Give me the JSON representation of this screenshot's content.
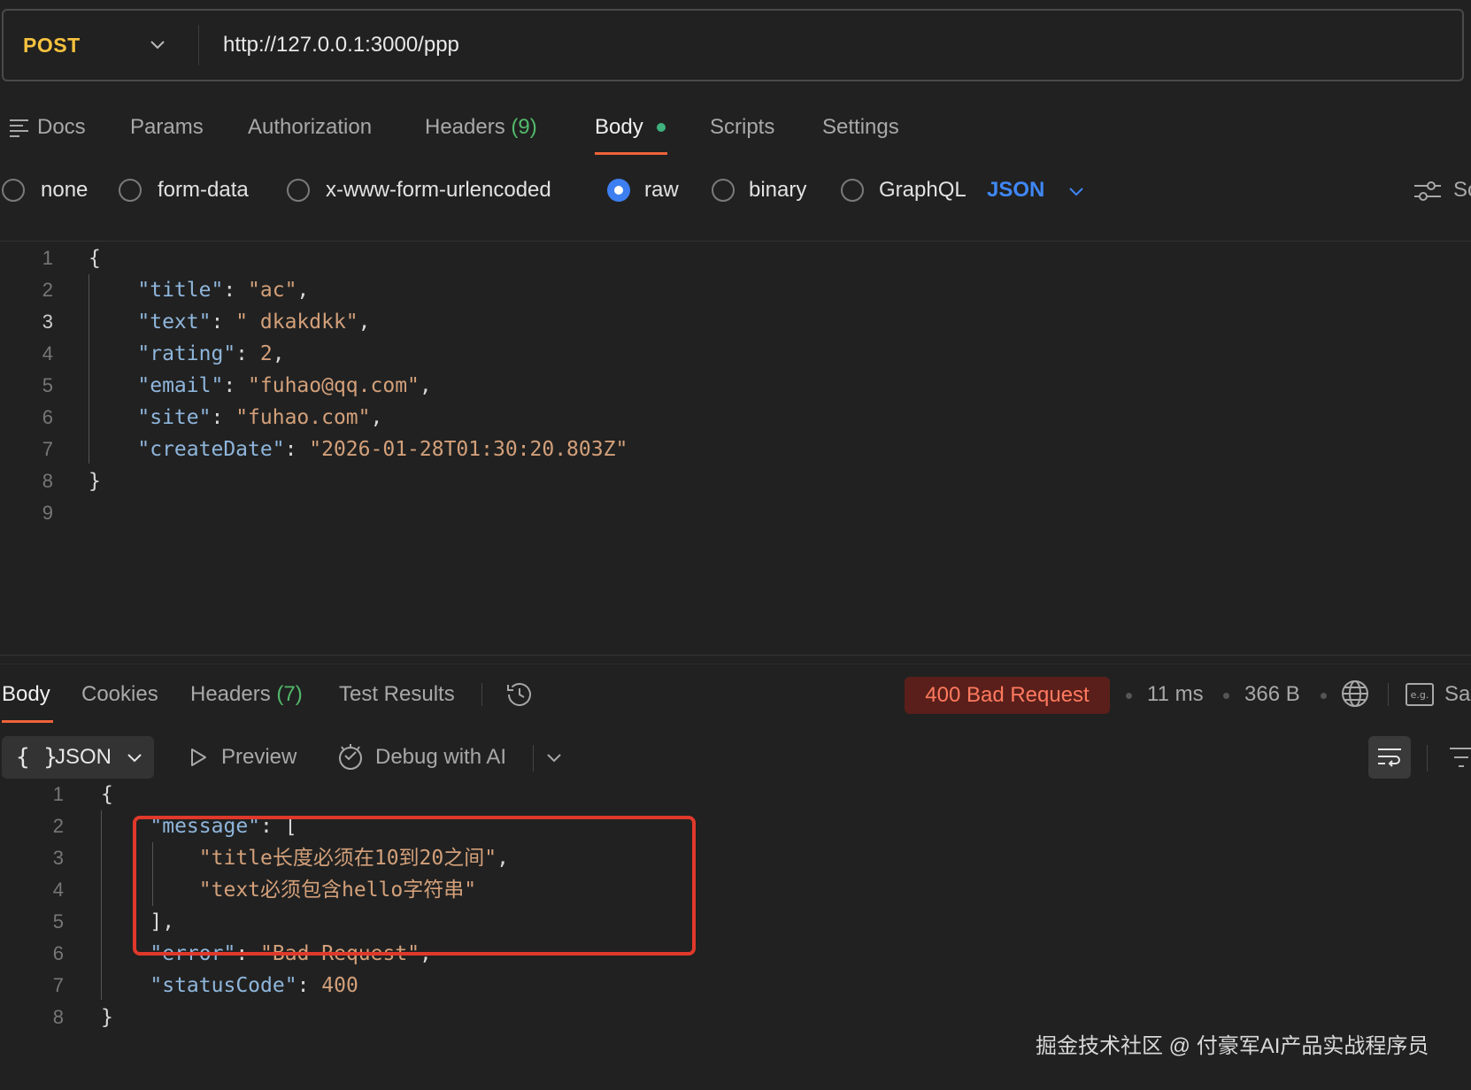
{
  "request": {
    "method": "POST",
    "url": "http://127.0.0.1:3000/ppp",
    "tabs": {
      "docs": "Docs",
      "params": "Params",
      "authorization": "Authorization",
      "headers": "Headers",
      "headers_count": "(9)",
      "body": "Body",
      "scripts": "Scripts",
      "settings": "Settings"
    },
    "body_types": [
      "none",
      "form-data",
      "x-www-form-urlencoded",
      "raw",
      "binary",
      "GraphQL"
    ],
    "selected_body_type": "raw",
    "language": "JSON",
    "beautify_label": "Sc",
    "line_numbers": [
      "1",
      "2",
      "3",
      "4",
      "5",
      "6",
      "7",
      "8",
      "9"
    ],
    "code": {
      "open": "{",
      "close": "}",
      "title_key": "\"title\"",
      "title_val": "\"ac\"",
      "text_key": "\"text\"",
      "text_val": "\" dkakdkk\"",
      "rating_key": "\"rating\"",
      "rating_val": "2",
      "email_key": "\"email\"",
      "email_val": "\"fuhao@qq.com\"",
      "site_key": "\"site\"",
      "site_val": "\"fuhao.com\"",
      "createDate_key": "\"createDate\"",
      "createDate_val": "\"2026-01-28T01:30:20.803Z\""
    }
  },
  "response": {
    "tabs": {
      "body": "Body",
      "cookies": "Cookies",
      "headers": "Headers",
      "headers_count": "(7)",
      "test_results": "Test Results"
    },
    "status": "400 Bad Request",
    "time": "11 ms",
    "size": "366 B",
    "save_label": "Sa",
    "format": "JSON",
    "format_braces": "{ }",
    "preview": "Preview",
    "debug_ai": "Debug with AI",
    "line_numbers": [
      "1",
      "2",
      "3",
      "4",
      "5",
      "6",
      "7",
      "8"
    ],
    "code": {
      "open": "{",
      "close": "}",
      "message_key": "\"message\"",
      "message_open": "[",
      "msg1": "\"title长度必须在10到20之间\"",
      "msg2": "\"text必须包含hello字符串\"",
      "message_close": "],",
      "error_key": "\"error\"",
      "error_val": "\"Bad Request\"",
      "status_key": "\"statusCode\"",
      "status_val": "400"
    }
  },
  "watermark": "掘金技术社区 @ 付豪军AI产品实战程序员",
  "colors": {
    "method": "#f6c23e",
    "accent_tab": "#f0633a",
    "status_error": "#ff7a5f",
    "highlight_box": "#e0392b",
    "json_key": "#8fb6dc",
    "json_string": "#d3a07a"
  }
}
